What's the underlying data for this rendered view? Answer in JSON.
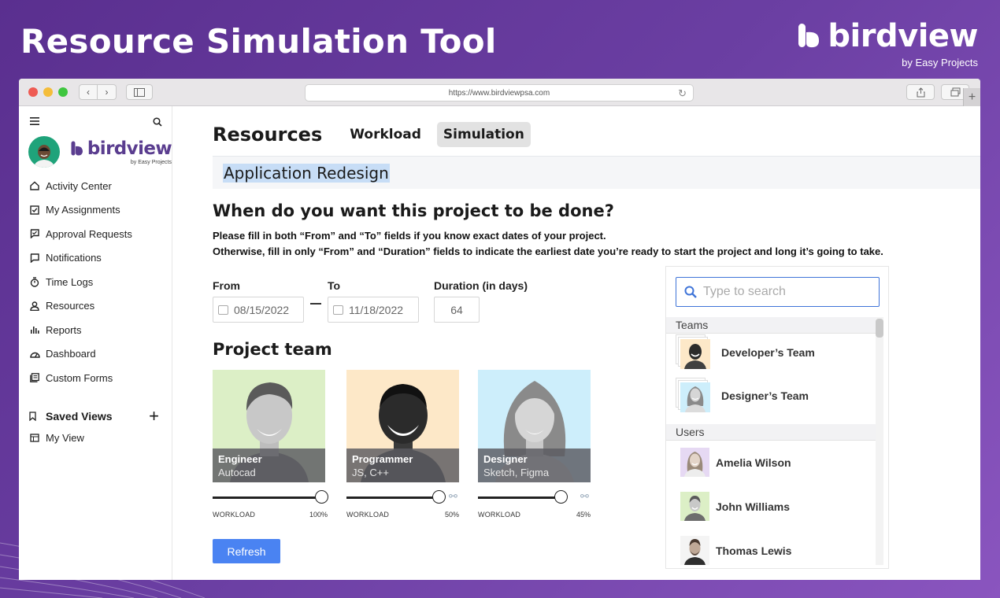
{
  "banner": {
    "title": "Resource Simulation Tool",
    "brand_name": "birdview",
    "brand_sub": "by Easy Projects"
  },
  "browser": {
    "url": "https://www.birdviewpsa.com",
    "dot_colors": [
      "#ee5b53",
      "#f4bd3a",
      "#3fc63f"
    ]
  },
  "sidebar": {
    "logo_name": "birdview",
    "logo_sub": "by Easy Projects",
    "items": [
      {
        "label": "Activity Center",
        "icon": "home-icon"
      },
      {
        "label": "My Assignments",
        "icon": "checkbox-icon"
      },
      {
        "label": "Approval Requests",
        "icon": "approval-icon"
      },
      {
        "label": "Notifications",
        "icon": "comment-icon"
      },
      {
        "label": "Time Logs",
        "icon": "stopwatch-icon"
      },
      {
        "label": "Resources",
        "icon": "person-icon"
      },
      {
        "label": "Reports",
        "icon": "bar-chart-icon"
      },
      {
        "label": "Dashboard",
        "icon": "gauge-icon"
      },
      {
        "label": "Custom Forms",
        "icon": "forms-icon"
      }
    ],
    "saved_views_label": "Saved Views",
    "saved_items": [
      {
        "label": "My View",
        "icon": "table-icon"
      }
    ]
  },
  "main": {
    "title": "Resources",
    "tabs": [
      {
        "label": "Workload",
        "active": false
      },
      {
        "label": "Simulation",
        "active": true
      }
    ],
    "project_name": "Application Redesign",
    "question": "When do you want this project to be done?",
    "desc_line1": "Please fill in both “From” and “To” fields if you know exact dates of your project.",
    "desc_line2": "Otherwise, fill in only “From” and “Duration” fields to indicate the earliest date you’re ready to start the project and long it’s going to take.",
    "from_label": "From",
    "from_value": "08/15/2022",
    "to_label": "To",
    "to_value": "11/18/2022",
    "duration_label": "Duration (in days)",
    "duration_value": "64",
    "team_title": "Project team",
    "team": [
      {
        "role": "Engineer",
        "skills": "Autocad",
        "workload_label": "WORKLOAD",
        "workload": "100%",
        "workload_fraction": 1.0,
        "bg": "#dcefc6"
      },
      {
        "role": "Programmer",
        "skills": "JS, C++",
        "workload_label": "WORKLOAD",
        "workload": "50%",
        "workload_fraction": 0.5,
        "bg": "#fde8c8"
      },
      {
        "role": "Designer",
        "skills": "Sketch, Figma",
        "workload_label": "WORKLOAD",
        "workload": "45%",
        "workload_fraction": 0.45,
        "bg": "#cdeefb"
      }
    ],
    "refresh_label": "Refresh"
  },
  "panel": {
    "search_placeholder": "Type to search",
    "teams_header": "Teams",
    "teams": [
      {
        "name": "Developer’s Team",
        "bg": "#fde8c8"
      },
      {
        "name": "Designer’s Team",
        "bg": "#cdeefb"
      }
    ],
    "users_header": "Users",
    "users": [
      {
        "name": "Amelia Wilson",
        "bg": "#e6d9f3"
      },
      {
        "name": "John Williams",
        "bg": "#dcefc6"
      },
      {
        "name": "Thomas Lewis",
        "bg": "#f4f4f4"
      }
    ]
  },
  "colors": {
    "accent_blue": "#4a83f2",
    "brand_purple": "#5a3d8f"
  }
}
